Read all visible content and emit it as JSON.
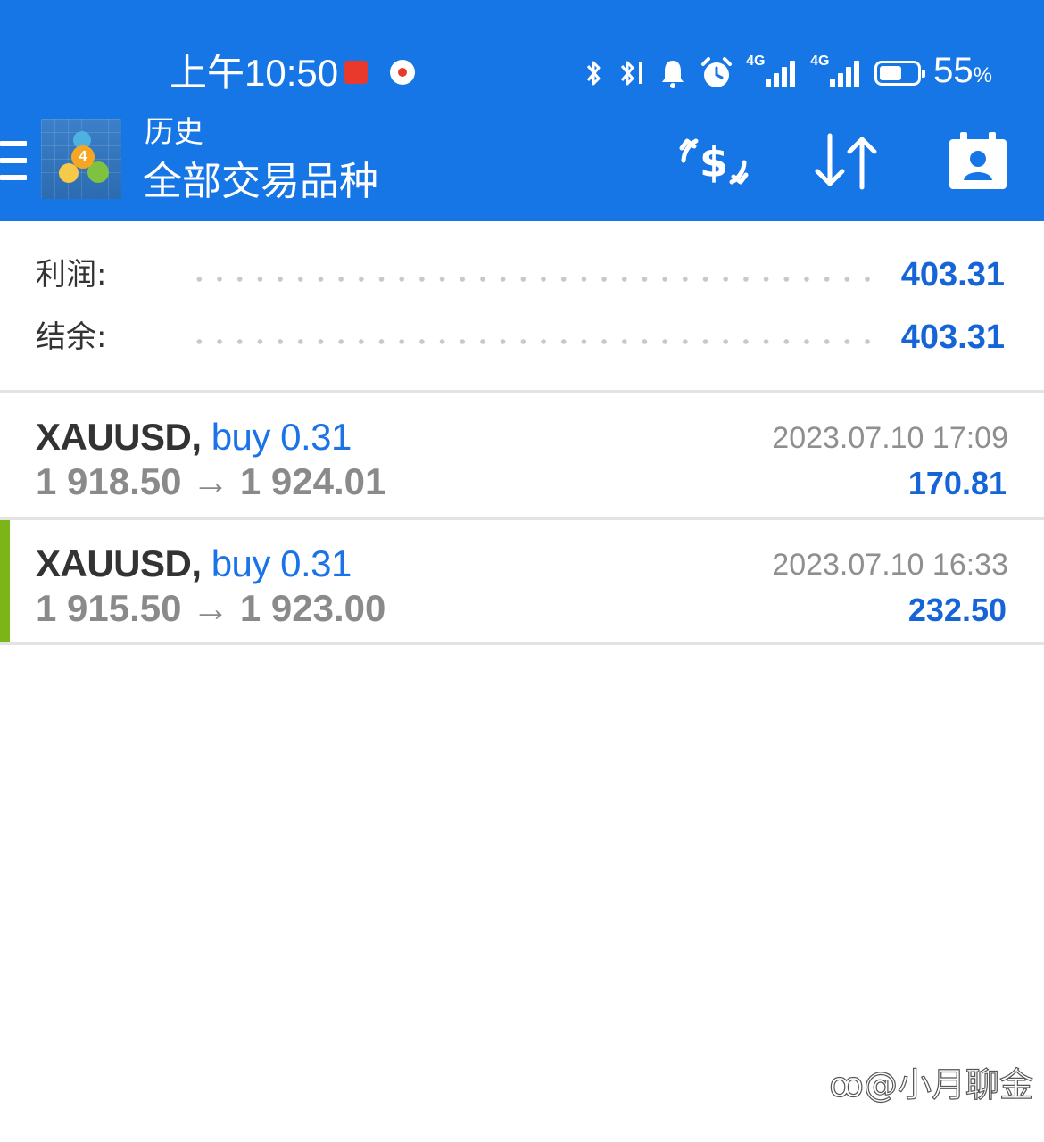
{
  "status_bar": {
    "time": "上午10:50",
    "network_1": "4G",
    "network_2": "4G",
    "battery": "55",
    "battery_unit": "%"
  },
  "header": {
    "subtitle": "历史",
    "title": "全部交易品种",
    "icons": [
      "menu-icon",
      "app-logo",
      "dollar-exchange-icon",
      "sort-icon",
      "contact-icon"
    ]
  },
  "summary": {
    "profit_label": "利润:",
    "profit_value": "403.31",
    "balance_label": "结余:",
    "balance_value": "403.31"
  },
  "trades": [
    {
      "symbol": "XAUUSD,",
      "side": "buy 0.31",
      "open_price": "1 918.50",
      "arrow": "→",
      "close_price": "1 924.01",
      "date": "2023.07.10 17:09",
      "profit": "170.81"
    },
    {
      "symbol": "XAUUSD,",
      "side": "buy 0.31",
      "open_price": "1 915.50",
      "arrow": "→",
      "close_price": "1 923.00",
      "date": "2023.07.10 16:33",
      "profit": "232.50"
    }
  ],
  "watermark": "@小月聊金",
  "colors": {
    "header_bg": "#1776e6",
    "value_blue": "#1565d8",
    "accent_green": "#7cb518"
  }
}
